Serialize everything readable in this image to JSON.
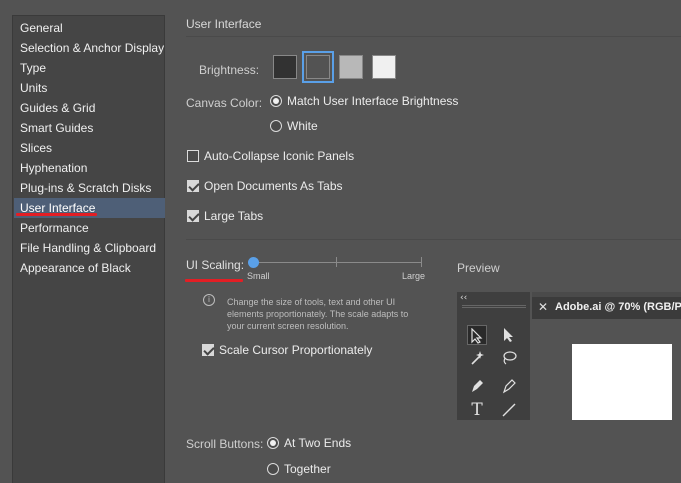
{
  "sidebar": {
    "items": [
      {
        "label": "General"
      },
      {
        "label": "Selection & Anchor Display"
      },
      {
        "label": "Type"
      },
      {
        "label": "Units"
      },
      {
        "label": "Guides & Grid"
      },
      {
        "label": "Smart Guides"
      },
      {
        "label": "Slices"
      },
      {
        "label": "Hyphenation"
      },
      {
        "label": "Plug-ins & Scratch Disks"
      },
      {
        "label": "User Interface"
      },
      {
        "label": "Performance"
      },
      {
        "label": "File Handling & Clipboard"
      },
      {
        "label": "Appearance of Black"
      }
    ],
    "selected": "User Interface"
  },
  "panel": {
    "title": "User Interface",
    "brightness": {
      "label": "Brightness:",
      "swatches": [
        "#323232",
        "#535353",
        "#b8b8b8",
        "#f0f0f0"
      ],
      "selected_index": 1
    },
    "canvas_color": {
      "label": "Canvas Color:",
      "option_match": "Match User Interface Brightness",
      "option_white": "White",
      "selected": "Match User Interface Brightness"
    },
    "auto_collapse": {
      "label": "Auto-Collapse Iconic Panels",
      "checked": false
    },
    "open_as_tabs": {
      "label": "Open Documents As Tabs",
      "checked": true
    },
    "large_tabs": {
      "label": "Large Tabs",
      "checked": true
    },
    "ui_scaling": {
      "label": "UI Scaling:",
      "min_label": "Small",
      "max_label": "Large",
      "value_fraction": 0,
      "help": "Change the size of tools, text and other UI elements proportionately. The scale adapts to your current screen resolution."
    },
    "scale_cursor": {
      "label": "Scale Cursor Proportionately",
      "checked": true
    },
    "preview": {
      "label": "Preview",
      "collapse_glyph": "‹‹",
      "doc_title": "Adobe.ai @ 70% (RGB/P"
    },
    "scroll_buttons": {
      "label": "Scroll Buttons:",
      "option_two_ends": "At Two Ends",
      "option_together": "Together",
      "selected": "At Two Ends"
    }
  },
  "colors": {
    "accent": "#5aa0e8",
    "selection_bg": "#4e5f77",
    "annotation_red": "#e31e24"
  }
}
